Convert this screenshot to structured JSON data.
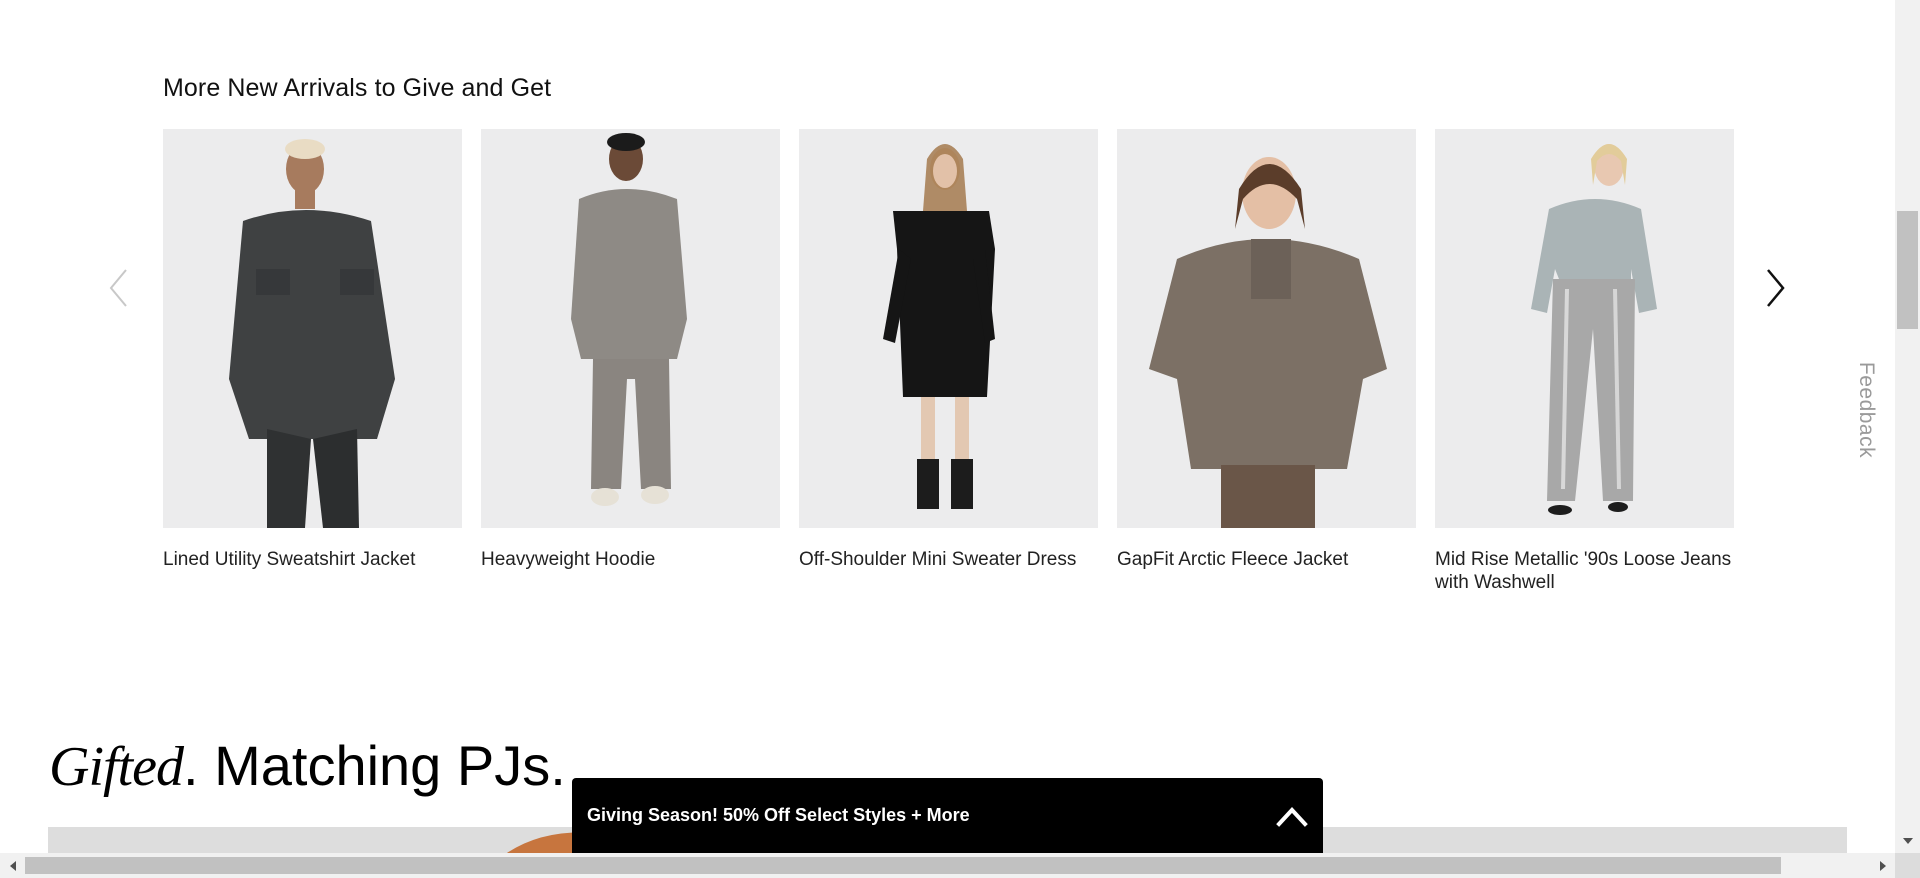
{
  "section": {
    "title": "More New Arrivals to Give and Get"
  },
  "products": [
    {
      "name": "Lined Utility Sweatshirt Jacket"
    },
    {
      "name": "Heavyweight Hoodie"
    },
    {
      "name": "Off-Shoulder Mini Sweater Dress"
    },
    {
      "name": "GapFit Arctic Fleece Jacket"
    },
    {
      "name": "Mid Rise Metallic '90s Loose Jeans with Washwell"
    }
  ],
  "carousel": {
    "prev_icon": "chevron-left-icon",
    "next_icon": "chevron-right-icon"
  },
  "feedback": {
    "label": "Feedback"
  },
  "gifted": {
    "italic": "Gifted",
    "rest": ". Matching PJs."
  },
  "promo": {
    "text": "Giving Season! 50% Off Select Styles + More",
    "icon": "chevron-up-icon"
  },
  "colors": {
    "background": "#ffffff",
    "promo_bg": "#000000",
    "image_bg": "#ededee",
    "text": "#1a1a1a"
  }
}
